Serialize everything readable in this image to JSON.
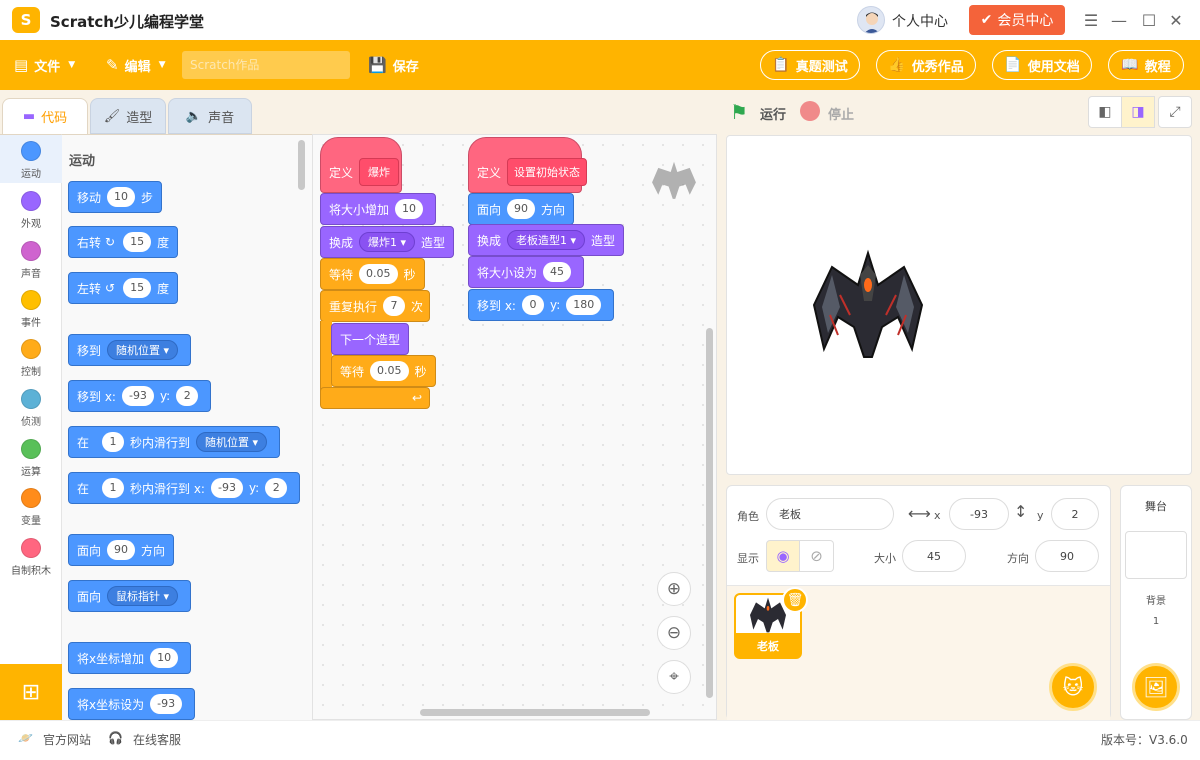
{
  "app": {
    "title": "Scratch少儿编程学堂",
    "logo_text": "S"
  },
  "titlebar": {
    "user_center": "个人中心",
    "vip": "会员中心"
  },
  "toolbar": {
    "file": "文件",
    "edit": "编辑",
    "project_placeholder": "Scratch作品",
    "save": "保存",
    "exam": "真题测试",
    "featured": "优秀作品",
    "docs": "使用文档",
    "tutorial": "教程"
  },
  "tabs": {
    "code": "代码",
    "costume": "造型",
    "sound": "声音"
  },
  "categories": [
    {
      "label": "运动",
      "color": "#4c97ff"
    },
    {
      "label": "外观",
      "color": "#9966ff"
    },
    {
      "label": "声音",
      "color": "#cf63cf"
    },
    {
      "label": "事件",
      "color": "#ffbf00"
    },
    {
      "label": "控制",
      "color": "#ffab19"
    },
    {
      "label": "侦测",
      "color": "#5cb1d6"
    },
    {
      "label": "运算",
      "color": "#59c059"
    },
    {
      "label": "变量",
      "color": "#ff8c1a"
    },
    {
      "label": "自制积木",
      "color": "#ff6680"
    }
  ],
  "palette": {
    "section_title": "运动",
    "move": {
      "t1": "移动",
      "v": "10",
      "t2": "步"
    },
    "turn_right": {
      "t1": "右转",
      "v": "15",
      "t2": "度"
    },
    "turn_left": {
      "t1": "左转",
      "v": "15",
      "t2": "度"
    },
    "goto": {
      "t1": "移到",
      "opt": "随机位置"
    },
    "goto_xy": {
      "t1": "移到 x:",
      "x": "-93",
      "t2": "y:",
      "y": "2"
    },
    "glide": {
      "t1": "在",
      "v": "1",
      "t2": "秒内滑行到",
      "opt": "随机位置"
    },
    "glide_xy": {
      "t1": "在",
      "v": "1",
      "t2": "秒内滑行到 x:",
      "x": "-93",
      "t3": "y:",
      "y": "2"
    },
    "point": {
      "t1": "面向",
      "v": "90",
      "t2": "方向"
    },
    "point_towards": {
      "t1": "面向",
      "opt": "鼠标指针"
    },
    "change_x": {
      "t1": "将x坐标增加",
      "v": "10"
    },
    "set_x": {
      "t1": "将x坐标设为",
      "v": "-93"
    }
  },
  "script1": {
    "define": "定义",
    "name": "爆炸",
    "change_size": {
      "t1": "将大小增加",
      "v": "10"
    },
    "switch": {
      "t1": "换成",
      "opt": "爆炸1",
      "t2": "造型"
    },
    "wait1": {
      "t1": "等待",
      "v": "0.05",
      "t2": "秒"
    },
    "repeat": {
      "t1": "重复执行",
      "v": "7",
      "t2": "次"
    },
    "next": "下一个造型",
    "wait2": {
      "t1": "等待",
      "v": "0.05",
      "t2": "秒"
    }
  },
  "script2": {
    "define": "定义",
    "name": "设置初始状态",
    "point": {
      "t1": "面向",
      "v": "90",
      "t2": "方向"
    },
    "switch": {
      "t1": "换成",
      "opt": "老板造型1",
      "t2": "造型"
    },
    "set_size": {
      "t1": "将大小设为",
      "v": "45"
    },
    "goto_xy": {
      "t1": "移到 x:",
      "x": "0",
      "t2": "y:",
      "y": "180"
    }
  },
  "stage_controls": {
    "run": "运行",
    "stop": "停止"
  },
  "sprite_info": {
    "sprite_label": "角色",
    "sprite_name": "老板",
    "x_label": "x",
    "x": "-93",
    "y_label": "y",
    "y": "2",
    "show_label": "显示",
    "size_label": "大小",
    "size": "45",
    "direction_label": "方向",
    "direction": "90"
  },
  "sprite_list": [
    {
      "name": "老板"
    }
  ],
  "stage_panel": {
    "title": "舞台",
    "backdrop_label": "背景",
    "backdrop_count": "1"
  },
  "statusbar": {
    "website": "官方网站",
    "support": "在线客服",
    "version": "版本号：V3.6.0"
  }
}
